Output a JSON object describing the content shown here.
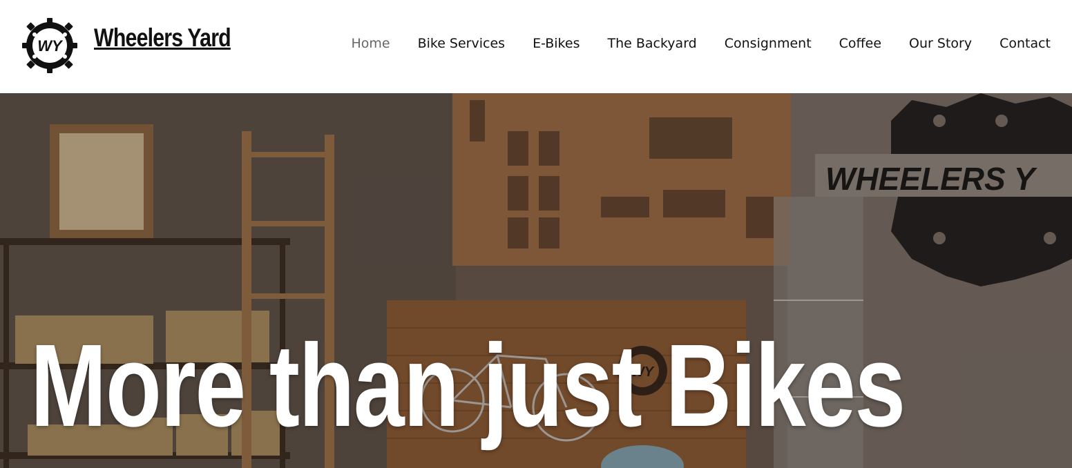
{
  "brand": {
    "name": "Wheelers Yard",
    "logo_text": "WY"
  },
  "nav": {
    "items": [
      {
        "label": "Home",
        "active": true
      },
      {
        "label": "Bike Services",
        "active": false
      },
      {
        "label": "E-Bikes",
        "active": false
      },
      {
        "label": "The Backyard",
        "active": false
      },
      {
        "label": "Consignment",
        "active": false
      },
      {
        "label": "Coffee",
        "active": false
      },
      {
        "label": "Our Story",
        "active": false
      },
      {
        "label": "Contact",
        "active": false
      }
    ]
  },
  "hero": {
    "title": "More than just Bikes",
    "wall_logo_text": "WHEELERS Y",
    "counter_logo_text": "WY"
  },
  "colors": {
    "nav_active": "#666666",
    "nav_text": "#111111",
    "hero_text": "#ffffff"
  }
}
